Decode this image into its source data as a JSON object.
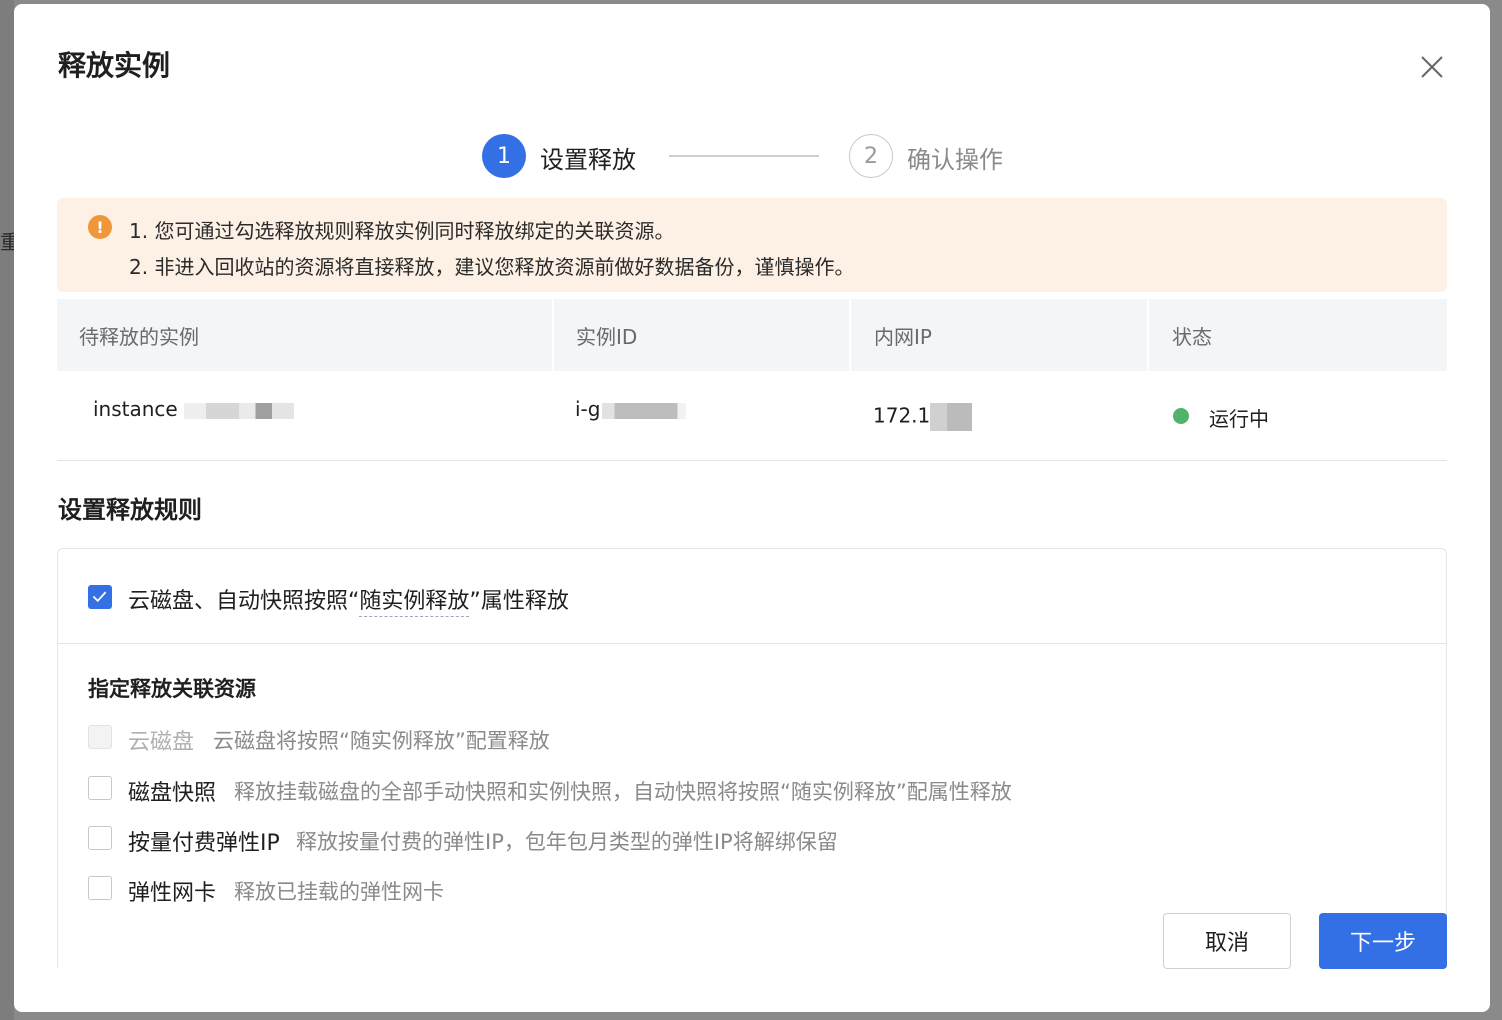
{
  "backdrop": {
    "partial_char": "重"
  },
  "dialog": {
    "title": "释放实例",
    "close_icon": "close-icon"
  },
  "steps": [
    {
      "number": "1",
      "label": "设置释放",
      "active": true
    },
    {
      "number": "2",
      "label": "确认操作",
      "active": false
    }
  ],
  "alert": {
    "icon": "warning-icon",
    "icon_glyph": "!",
    "color": "#f0973b",
    "lines": [
      "1. 您可通过勾选释放规则释放实例同时释放绑定的关联资源。",
      "2. 非进入回收站的资源将直接释放，建议您释放资源前做好数据备份，谨慎操作。"
    ]
  },
  "table": {
    "columns": [
      "待释放的实例",
      "实例ID",
      "内网IP",
      "状态"
    ],
    "rows": [
      {
        "instance_name": "instance",
        "instance_id": "i-g",
        "private_ip": "172.1",
        "status": "运行中",
        "status_color": "#52b16b"
      }
    ]
  },
  "rules": {
    "section_title": "设置释放规则",
    "main_rule": {
      "checked": true,
      "prefix": "云磁盘、自动快照按照“",
      "link": "随实例释放",
      "suffix": "”属性释放"
    },
    "subsection_title": "指定释放关联资源",
    "options": [
      {
        "label": "云磁盘",
        "description": "云磁盘将按照“随实例释放”配置释放",
        "checked": false,
        "disabled": true
      },
      {
        "label": "磁盘快照",
        "description": "释放挂载磁盘的全部手动快照和实例快照，自动快照将按照“随实例释放”配属性释放",
        "checked": false,
        "disabled": false
      },
      {
        "label": "按量付费弹性IP",
        "description": "释放按量付费的弹性IP，包年包月类型的弹性IP将解绑保留",
        "checked": false,
        "disabled": false
      },
      {
        "label": "弹性网卡",
        "description": "释放已挂载的弹性网卡",
        "checked": false,
        "disabled": false
      }
    ]
  },
  "footer": {
    "cancel_label": "取消",
    "next_label": "下一步",
    "primary_color": "#3370e6"
  }
}
